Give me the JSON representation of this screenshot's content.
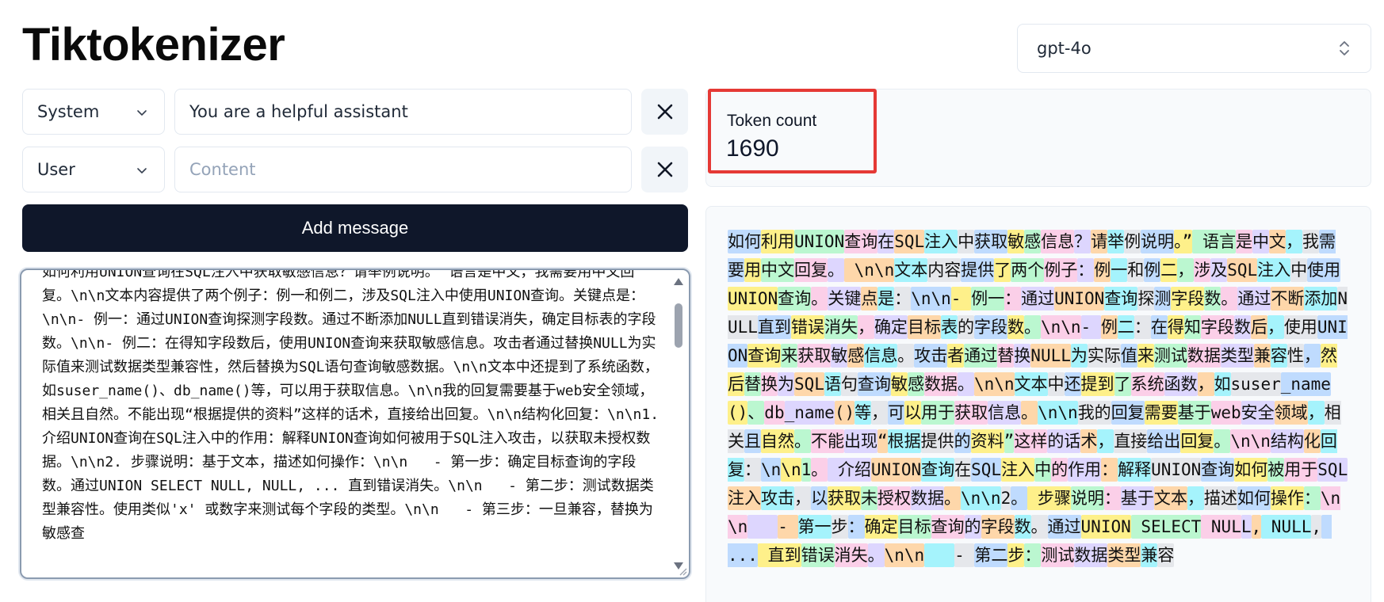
{
  "app": {
    "title": "Tiktokenizer",
    "model": "gpt-4o"
  },
  "messages": [
    {
      "role": "System",
      "content": "You are a helpful assistant",
      "placeholder": "Content"
    },
    {
      "role": "User",
      "content": "",
      "placeholder": "Content"
    }
  ],
  "add_message_label": "Add message",
  "raw_text": "如何利用UNION查询在SQL注入中获取敏感信息？请举例说明。” 语言是中文，我需要用中文回复。\\n\\n文本内容提供了两个例子：例一和例二，涉及SQL注入中使用UNION查询。关键点是：\\n\\n- 例一：通过UNION查询探测字段数。通过不断添加NULL直到错误消失，确定目标表的字段数。\\n\\n- 例二：在得知字段数后，使用UNION查询来获取敏感信息。攻击者通过替换NULL为实际值来测试数据类型兼容性，然后替换为SQL语句查询敏感数据。\\n\\n文本中还提到了系统函数，如suser_name()、db_name()等，可以用于获取信息。\\n\\n我的回复需要基于web安全领域，相关且自然。不能出现“根据提供的资料”这样的话术，直接给出回复。\\n\\n结构化回复：\\n\\n1. 介绍UNION查询在SQL注入中的作用：解释UNION查询如何被用于SQL注入攻击，以获取未授权数据。\\n\\n2. 步骤说明：基于文本，描述如何操作：\\n\\n   - 第一步：确定目标查询的字段数。通过UNION SELECT NULL, NULL, ... 直到错误消失。\\n\\n   - 第二步：测试数据类型兼容性。使用类似'x' 或数字来测试每个字段的类型。\\n\\n   - 第三步：一旦兼容，替换为敏感查",
  "token_count": {
    "label": "Token count",
    "value": "1690"
  },
  "tokens": [
    "如何",
    "利用",
    "UNION",
    "查询",
    "在",
    "SQL",
    "注入",
    "中",
    "获取",
    "敏",
    "感",
    "信息",
    "？",
    "请",
    "举",
    "例",
    "说明",
    "。”",
    " 语言",
    "是",
    "中",
    "文",
    "，",
    "我",
    "需要",
    "用",
    "中文",
    "回复",
    "。",
    " \\n\\n",
    "文本",
    "内容",
    "提供",
    "了",
    "两个",
    "例子",
    "：",
    "例",
    "一",
    "和",
    "例",
    "二",
    "，",
    "涉",
    "及",
    "SQL",
    "注入",
    "中",
    "使用",
    "UNION",
    "查询",
    "。",
    "关键",
    "点",
    "是",
    "：",
    "\\n\\n",
    "- ",
    "例一",
    "：",
    "通过",
    "UNION",
    "查询",
    "探",
    "测",
    "字段",
    "数",
    "。",
    "通过",
    "不断",
    "添加",
    "NULL",
    "直到",
    "错误",
    "消失",
    "，",
    "确定",
    "目标",
    "表",
    "的",
    "字段",
    "数",
    "。",
    "\\n\\n",
    "- ",
    "例",
    "二",
    "：",
    "在",
    "得",
    "知",
    "字段",
    "数",
    "后",
    "，",
    "使用",
    "UNION",
    "查询",
    "来",
    "获取",
    "敏",
    "感",
    "信息",
    "。",
    "攻击",
    "者",
    "通过",
    "替",
    "换",
    "NULL",
    "为",
    "实际",
    "值",
    "来",
    "测试",
    "数据",
    "类型",
    "兼",
    "容",
    "性",
    "，",
    "然后",
    "替",
    "换",
    "为",
    "SQL",
    "语",
    "句",
    "查询",
    "敏",
    "感",
    "数据",
    "。",
    "\\n\\n",
    "文本",
    "中",
    "还",
    "提到",
    "了",
    "系统",
    "函数",
    "，",
    "如",
    "suser",
    "_name",
    "()",
    "、",
    "db",
    "_name",
    "()",
    "等",
    "，",
    "可",
    "以",
    "用于",
    "获取",
    "信息",
    "。",
    "\\n\\n",
    "我的",
    "回复",
    "需要",
    "基于",
    "web",
    "安全",
    "领域",
    "，",
    "相关",
    "且",
    "自然",
    "。",
    "不能",
    "出现",
    "“",
    "根据",
    "提供",
    "的",
    "资料",
    "”",
    "这样",
    "的话",
    "术",
    "，",
    "直接",
    "给出",
    "回复",
    "。",
    "\\n\\n",
    "结构",
    "化",
    "回复",
    "：",
    "\\n",
    "\\n",
    "1",
    "。",
    " 介绍",
    "UNION",
    "查询",
    "在",
    "SQL",
    "注入",
    "中",
    "的",
    "作用",
    "：",
    "解释",
    "UNION",
    "查询",
    "如何",
    "被",
    "用于",
    "SQL",
    "注入",
    "攻击",
    "，",
    "以",
    "获取",
    "未",
    "授权",
    "数据",
    "。",
    "\\n\\n",
    "2",
    "。",
    " 步骤",
    "说明",
    "：",
    "基于",
    "文本",
    "，",
    "描述",
    "如何",
    "操作",
    "：",
    "\\n\\n",
    "   ",
    "- ",
    "第一",
    "步",
    "：",
    "确定",
    "目标",
    "查询",
    "的",
    "字段",
    "数",
    "。",
    "通过",
    "UNION",
    " SELECT",
    " NUL",
    "L",
    ",",
    " NULL",
    ",",
    " ...",
    " 直到",
    "错误",
    "消失",
    "。",
    "\\n\\n",
    "   ",
    "- ",
    "第二",
    "步",
    "：",
    "测试",
    "数据",
    "类型",
    "兼",
    "容"
  ],
  "token_palette": [
    "#bfdbfe",
    "#fef08a",
    "#bbf7d0",
    "#fbcfe8",
    "#ddd6fe",
    "#fed7aa",
    "#a5f3fc",
    "#e5e7eb"
  ],
  "icons": {
    "model_select": "updown-chevron-icon",
    "role_select": "chevron-down-icon",
    "remove": "close-icon"
  }
}
